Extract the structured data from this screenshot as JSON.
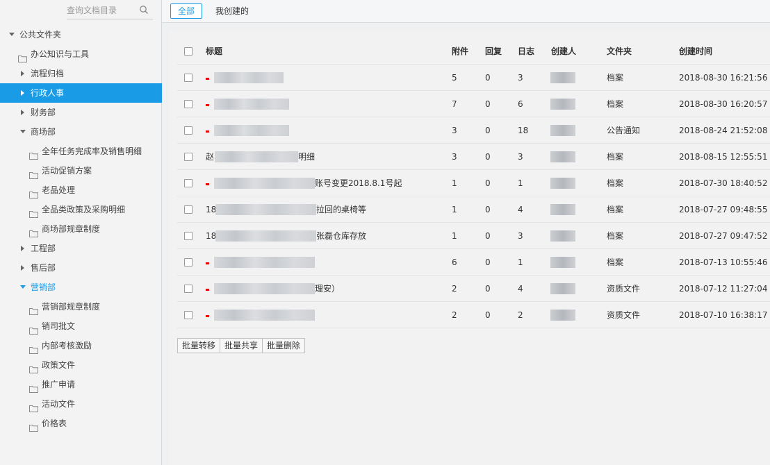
{
  "search": {
    "placeholder": "查询文档目录"
  },
  "tree": [
    {
      "label": "公共文件夹",
      "level": 0,
      "caret": "down",
      "folder": false,
      "state": ""
    },
    {
      "label": "办公知识与工具",
      "level": 1,
      "caret": "",
      "folder": true,
      "state": ""
    },
    {
      "label": "流程归档",
      "level": 1,
      "caret": "right",
      "folder": false,
      "state": ""
    },
    {
      "label": "行政人事",
      "level": 1,
      "caret": "right",
      "folder": false,
      "state": "active"
    },
    {
      "label": "财务部",
      "level": 1,
      "caret": "right",
      "folder": false,
      "state": ""
    },
    {
      "label": "商场部",
      "level": 1,
      "caret": "down",
      "folder": false,
      "state": ""
    },
    {
      "label": "全年任务完成率及销售明细",
      "level": 2,
      "caret": "",
      "folder": true,
      "state": ""
    },
    {
      "label": "活动促销方案",
      "level": 2,
      "caret": "",
      "folder": true,
      "state": ""
    },
    {
      "label": "老品处理",
      "level": 2,
      "caret": "",
      "folder": true,
      "state": ""
    },
    {
      "label": "全品类政策及采购明细",
      "level": 2,
      "caret": "",
      "folder": true,
      "state": ""
    },
    {
      "label": "商场部规章制度",
      "level": 2,
      "caret": "",
      "folder": true,
      "state": ""
    },
    {
      "label": "工程部",
      "level": 1,
      "caret": "right",
      "folder": false,
      "state": ""
    },
    {
      "label": "售后部",
      "level": 1,
      "caret": "right",
      "folder": false,
      "state": ""
    },
    {
      "label": "营销部",
      "level": 1,
      "caret": "down",
      "folder": false,
      "state": "open-blue"
    },
    {
      "label": "营销部规章制度",
      "level": 2,
      "caret": "",
      "folder": true,
      "state": ""
    },
    {
      "label": "销司批文",
      "level": 2,
      "caret": "",
      "folder": true,
      "state": ""
    },
    {
      "label": "内部考核激励",
      "level": 2,
      "caret": "",
      "folder": true,
      "state": ""
    },
    {
      "label": "政策文件",
      "level": 2,
      "caret": "",
      "folder": true,
      "state": ""
    },
    {
      "label": "推广申请",
      "level": 2,
      "caret": "",
      "folder": true,
      "state": ""
    },
    {
      "label": "活动文件",
      "level": 2,
      "caret": "",
      "folder": true,
      "state": ""
    },
    {
      "label": "价格表",
      "level": 2,
      "caret": "",
      "folder": true,
      "state": ""
    }
  ],
  "tabs": {
    "all": "全部",
    "mine": "我创建的"
  },
  "columns": {
    "title": "标题",
    "attach": "附件",
    "reply": "回复",
    "log": "日志",
    "creator": "创建人",
    "folder": "文件夹",
    "created": "创建时间"
  },
  "rows": [
    {
      "dot": true,
      "prefix": "",
      "suffix": "",
      "attach": "5",
      "reply": "0",
      "log": "3",
      "folder": "档案",
      "created": "2018-08-30 16:21:56"
    },
    {
      "dot": true,
      "prefix": "",
      "suffix": "",
      "attach": "7",
      "reply": "0",
      "log": "6",
      "folder": "档案",
      "created": "2018-08-30 16:20:57"
    },
    {
      "dot": true,
      "prefix": "",
      "suffix": "",
      "attach": "3",
      "reply": "0",
      "log": "18",
      "folder": "公告通知",
      "created": "2018-08-24 21:52:08"
    },
    {
      "dot": false,
      "prefix": "赵",
      "suffix": "明细",
      "attach": "3",
      "reply": "0",
      "log": "3",
      "folder": "档案",
      "created": "2018-08-15 12:55:51"
    },
    {
      "dot": true,
      "prefix": "",
      "suffix": "账号变更2018.8.1号起",
      "attach": "1",
      "reply": "0",
      "log": "1",
      "folder": "档案",
      "created": "2018-07-30 18:40:52"
    },
    {
      "dot": false,
      "prefix": "18",
      "suffix": "拉回的桌椅等",
      "attach": "1",
      "reply": "0",
      "log": "4",
      "folder": "档案",
      "created": "2018-07-27 09:48:55"
    },
    {
      "dot": false,
      "prefix": "18",
      "suffix": "张磊仓库存放",
      "attach": "1",
      "reply": "0",
      "log": "3",
      "folder": "档案",
      "created": "2018-07-27 09:47:52"
    },
    {
      "dot": true,
      "prefix": "",
      "suffix": "",
      "attach": "6",
      "reply": "0",
      "log": "1",
      "folder": "档案",
      "created": "2018-07-13 10:55:46"
    },
    {
      "dot": true,
      "prefix": "",
      "suffix": "理安）",
      "attach": "2",
      "reply": "0",
      "log": "4",
      "folder": "资质文件",
      "created": "2018-07-12 11:27:04"
    },
    {
      "dot": true,
      "prefix": "",
      "suffix": "",
      "attach": "2",
      "reply": "0",
      "log": "2",
      "folder": "资质文件",
      "created": "2018-07-10 16:38:17"
    }
  ],
  "bulk": {
    "move": "批量转移",
    "share": "批量共享",
    "delete": "批量删除"
  }
}
